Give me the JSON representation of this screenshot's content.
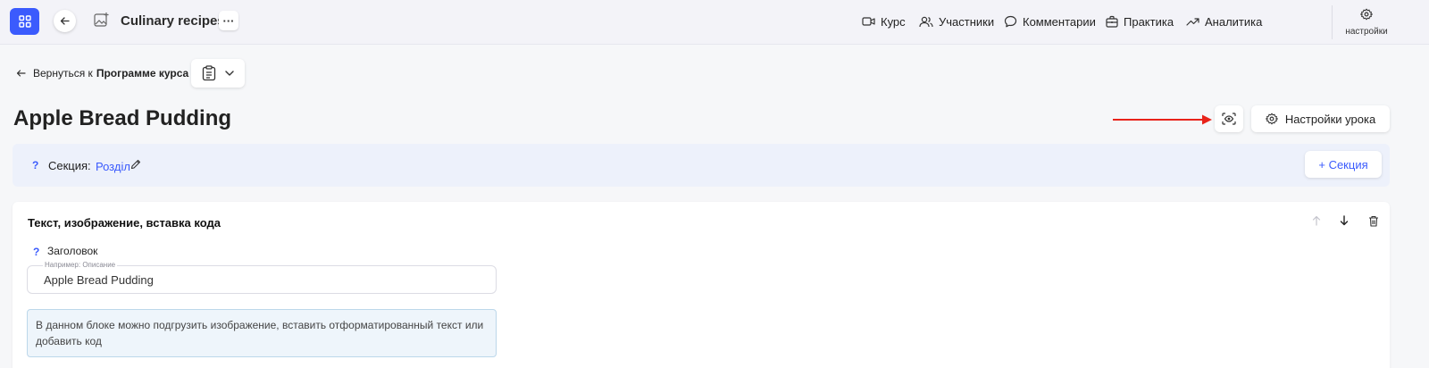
{
  "topbar": {
    "course_title": "Culinary recipes",
    "more_label": "···",
    "nav": [
      {
        "label": "Курс",
        "icon": "video-icon"
      },
      {
        "label": "Участники",
        "icon": "users-icon"
      },
      {
        "label": "Комментарии",
        "icon": "comment-icon"
      },
      {
        "label": "Практика",
        "icon": "briefcase-icon"
      },
      {
        "label": "Аналитика",
        "icon": "trending-up-icon"
      }
    ],
    "settings_label": "настройки"
  },
  "breadcrumb": {
    "prefix": "Вернуться к",
    "target": "Программе курса"
  },
  "lesson": {
    "title": "Apple Bread Pudding",
    "settings_button": "Настройки урока"
  },
  "section": {
    "help": "?",
    "label": "Секция:",
    "value": "Розділ",
    "add_button": "+ Секция"
  },
  "block": {
    "title": "Текст, изображение, вставка кода",
    "field_help": "?",
    "field_label": "Заголовок",
    "input_legend": "Например: Описание",
    "input_value": "Apple Bread Pudding",
    "info_text": "В данном блоке можно подгрузить изображение, вставить отформатированный текст или добавить код"
  },
  "colors": {
    "accent": "#3b5bfd",
    "annotation_arrow": "#e8231a"
  }
}
